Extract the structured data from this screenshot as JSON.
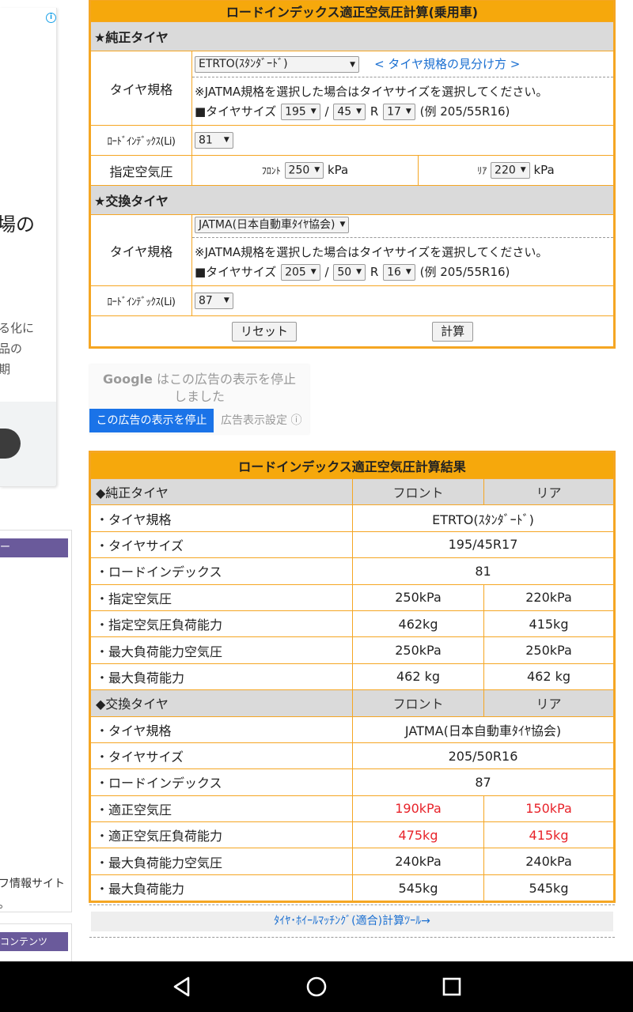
{
  "sidebar": {
    "ad_heading": "場の",
    "ad_body_lines": [
      "る化に",
      "品の",
      "期"
    ],
    "widget1_header": "ー",
    "widget1_foot_lines": [
      "フ情報サイト",
      "。"
    ],
    "widget2_header": "コンテンツ"
  },
  "calc": {
    "title": "ロードインデックス適正空気圧計算(乗用車)",
    "oem_section": "★純正タイヤ",
    "replacement_section": "★交換タイヤ",
    "tire_spec_label": "タイヤ規格",
    "load_index_label": "ﾛｰﾄﾞｲﾝﾃﾞｯｸｽ(Li)",
    "pressure_label": "指定空気圧",
    "note": "※JATMA規格を選択した場合はタイヤサイズを選択してください。",
    "size_label": "■タイヤサイズ",
    "size_slash": "/",
    "size_r": "R",
    "size_example": "(例 205/55R16)",
    "spec_guide_link": "< タイヤ規格の見分け方 >",
    "oem": {
      "standard": "ETRTO(ｽﾀﾝﾀﾞｰﾄﾞ)",
      "width": "195",
      "aspect": "45",
      "rim": "17",
      "load_index": "81",
      "front_label": "ﾌﾛﾝﾄ",
      "front_pressure": "250",
      "rear_label": "ﾘｱ",
      "rear_pressure": "220",
      "unit": "kPa"
    },
    "replacement": {
      "standard": "JATMA(日本自動車ﾀｲﾔ協会)",
      "width": "205",
      "aspect": "50",
      "rim": "16",
      "load_index": "87"
    },
    "reset_button": "リセット",
    "calc_button": "計算"
  },
  "google_ad": {
    "google_word": "Google",
    "message_line1": "はこの広告の表示を停止",
    "message_line2": "しました",
    "stop_button": "この広告の表示を停止",
    "settings_link": "広告表示設定 ⓘ"
  },
  "result": {
    "title": "ロードインデックス適正空気圧計算結果",
    "oem_section": "◆純正タイヤ",
    "replacement_section": "◆交換タイヤ",
    "front_header": "フロント",
    "rear_header": "リア",
    "oem_rows": [
      {
        "label": "・タイヤ規格",
        "value": "ETRTO(ｽﾀﾝﾀﾞｰﾄﾞ)"
      },
      {
        "label": "・タイヤサイズ",
        "value": "195/45R17"
      },
      {
        "label": "・ロードインデックス",
        "value": "81"
      },
      {
        "label": "・指定空気圧",
        "front": "250kPa",
        "rear": "220kPa"
      },
      {
        "label": "・指定空気圧負荷能力",
        "front": "462kg",
        "rear": "415kg"
      },
      {
        "label": "・最大負荷能力空気圧",
        "front": "250kPa",
        "rear": "250kPa"
      },
      {
        "label": "・最大負荷能力",
        "front": "462 kg",
        "rear": "462 kg"
      }
    ],
    "replacement_rows": [
      {
        "label": "・タイヤ規格",
        "value": "JATMA(日本自動車ﾀｲﾔ協会)"
      },
      {
        "label": "・タイヤサイズ",
        "value": "205/50R16"
      },
      {
        "label": "・ロードインデックス",
        "value": "87"
      },
      {
        "label": "・適正空気圧",
        "front": "190kPa",
        "rear": "150kPa"
      },
      {
        "label": "・適正空気圧負荷能力",
        "front": "475kg",
        "rear": "415kg"
      },
      {
        "label": "・最大負荷能力空気圧",
        "front": "240kPa",
        "rear": "240kPa"
      },
      {
        "label": "・最大負荷能力",
        "front": "545kg",
        "rear": "545kg"
      }
    ],
    "highlight_color": "#e8232a"
  },
  "tool_link": "ﾀｲﾔ･ﾎｲｰﾙﾏｯﾁﾝｸﾞ(適合)計算ﾂｰﾙ→",
  "navbar": {
    "icons": [
      "back-icon",
      "home-icon",
      "recents-icon"
    ]
  },
  "colors": {
    "accent_orange": "#f6a80c",
    "section_gray": "#dadada",
    "link_blue": "#1a6fd1",
    "sidebar_purple": "#6a5a9b"
  }
}
